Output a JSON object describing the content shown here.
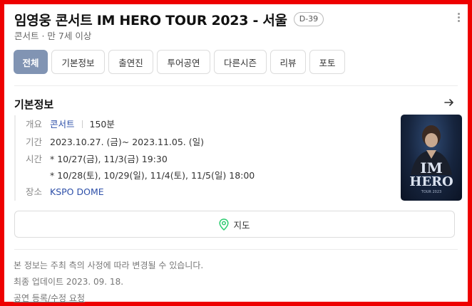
{
  "header": {
    "title": "임영웅 콘서트 IM HERO TOUR 2023 - 서울",
    "dday": "D-39",
    "subtitle": "콘서트 · 만 7세 이상",
    "more_icon": "more-vertical-icon"
  },
  "tabs": [
    {
      "label": "전체",
      "active": true
    },
    {
      "label": "기본정보",
      "active": false
    },
    {
      "label": "출연진",
      "active": false
    },
    {
      "label": "투어공연",
      "active": false
    },
    {
      "label": "다른시즌",
      "active": false
    },
    {
      "label": "리뷰",
      "active": false
    },
    {
      "label": "포토",
      "active": false
    }
  ],
  "section": {
    "title": "기본정보",
    "arrow_icon": "arrow-right-icon"
  },
  "info": {
    "overview_label": "개요",
    "genre": "콘서트",
    "runtime": "150분",
    "period_label": "기간",
    "period": "2023.10.27. (금)~ 2023.11.05. (일)",
    "time_label": "시간",
    "time_line1": "* 10/27(금), 11/3(금) 19:30",
    "time_line2": "* 10/28(토), 10/29(일), 11/4(토), 11/5(일) 18:00",
    "venue_label": "장소",
    "venue": "KSPO DOME"
  },
  "poster": {
    "headline_line1": "IM",
    "headline_line2": "HERO",
    "tour_text": "TOUR 2023"
  },
  "map_button": {
    "label": "지도",
    "icon": "map-pin-icon",
    "icon_color": "#2ecc71"
  },
  "footer": {
    "notice": "본 정보는 주최 측의 사정에 따라 변경될 수 있습니다.",
    "updated": "최종 업데이트 2023. 09. 18.",
    "request_link": "공연 등록/수정 요청"
  },
  "colors": {
    "active_tab": "#8194b3",
    "link": "#2d4fa8",
    "frame_border": "#ee0000"
  }
}
